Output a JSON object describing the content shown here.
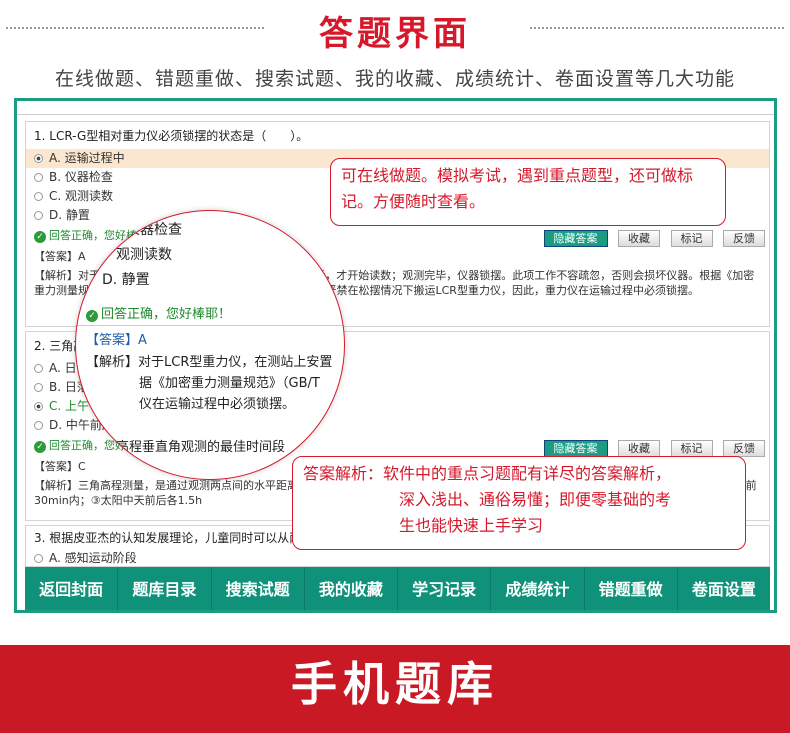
{
  "header": {
    "title": "答题界面",
    "subtitle": "在线做题、错题重做、搜索试题、我的收藏、成绩统计、卷面设置等几大功能"
  },
  "q1": {
    "text": "1. LCR-G型相对重力仪必须锁摆的状态是（　　）。",
    "options": [
      "A. 运输过程中",
      "B. 仪器检查",
      "C. 观测读数",
      "D. 静置"
    ],
    "correct": "回答正确，您好棒耶！",
    "answer": "【答案】A",
    "analysis": "【解析】对于LCR型重力仪，在测站上安置，在开摆5min后，才开始读数；观测完毕，仪器锁摆。此项工作不容疏忽，否则会损坏仪器。根据《加密重力测量规范》，条规定，禁止将重力仪大角度倾斜或卧置，严禁在松摆情况下搬运LCR型重力仪，因此，重力仪在运输过程中必须锁摆。"
  },
  "buttons": {
    "hide": "隐藏答案",
    "fav": "收藏",
    "mark": "标记",
    "feedback": "反馈"
  },
  "q2": {
    "text": "2. 三角高程垂直角观测的最佳时间段",
    "options": [
      "A. 日出前后",
      "B. 日落前后",
      "C. 上午",
      "D. 中午前后"
    ],
    "correct": "回答正确，您好棒耶！",
    "answer": "【答案】C",
    "analysis": "【解析】三角高程测量，是通过观测两点间的水平距离和垂直角求定两点间高差的方法。括：①在阴天或者光照不强的时间段；②日出后内；③日落前30min内；③太阳中天前后各1.5h"
  },
  "q3": {
    "text": "3. 根据皮亚杰的认知发展理论，儿童同时可以从两个或两",
    "option": "A. 感知运动阶段"
  },
  "lens": {
    "l1": "仪器检查",
    "l2": "观测读数",
    "l3": "D. 静置",
    "ok": "回答正确，您好棒耶！",
    "ans": "【答案】A",
    "an1": "【解析】对于LCR型重力仪，在测站上安置",
    "an2": "据《加密重力测量规范》（GB/T",
    "an3": "仪在运输过程中必须锁摆。",
    "q2": "高程垂直角观测的最佳时间段"
  },
  "callouts": {
    "c1": "可在线做题。模拟考试，遇到重点题型，还可做标记。方便随时查看。",
    "c2a": "答案解析：软件中的重点习题配有详尽的答案解析，",
    "c2b": "深入浅出、通俗易懂；即便零基础的考",
    "c2c": "生也能快速上手学习"
  },
  "nav": [
    "返回封面",
    "题库目录",
    "搜索试题",
    "我的收藏",
    "学习记录",
    "成绩统计",
    "错题重做",
    "卷面设置"
  ],
  "footer": {
    "title": "手机题库"
  },
  "colors": {
    "accent": "#d6182a",
    "teal": "#1d9c84"
  }
}
